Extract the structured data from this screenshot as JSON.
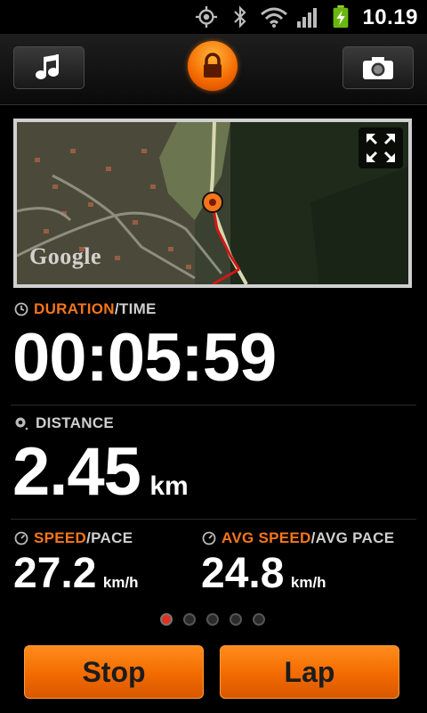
{
  "status_bar": {
    "time": "10.19",
    "icons": [
      "gps-icon",
      "bluetooth-icon",
      "wifi-icon",
      "signal-icon",
      "battery-charging-icon"
    ]
  },
  "toolbar": {
    "left_button_icon": "music-note-icon",
    "center_button_icon": "lock-icon",
    "right_button_icon": "camera-icon"
  },
  "map": {
    "provider_logo": "Google",
    "expand_icon": "expand-icon"
  },
  "duration": {
    "label_primary": "DURATION",
    "label_secondary": "/TIME",
    "value": "00:05:59"
  },
  "distance": {
    "label": "DISTANCE",
    "value": "2.45",
    "unit": "km"
  },
  "speed": {
    "label_primary": "SPEED",
    "label_secondary": "/PACE",
    "value": "27.2",
    "unit": "km/h"
  },
  "avg_speed": {
    "label_primary": "AVG SPEED",
    "label_secondary": "/AVG PACE",
    "value": "24.8",
    "unit": "km/h"
  },
  "pager": {
    "count": 5,
    "active": 1
  },
  "buttons": {
    "stop": "Stop",
    "lap": "Lap"
  },
  "colors": {
    "accent": "#f5761a",
    "button": "#f26a00",
    "active_dot": "#e0301e"
  }
}
